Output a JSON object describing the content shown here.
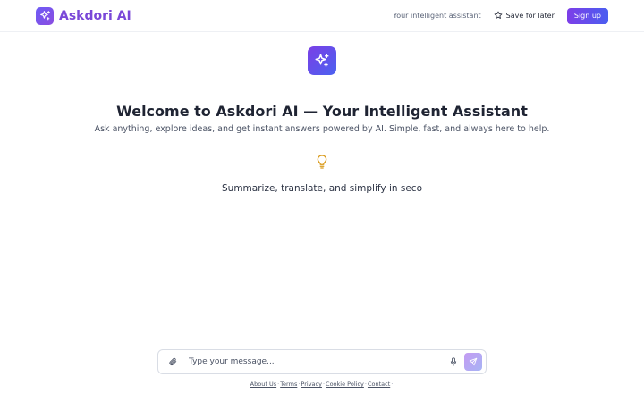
{
  "app": {
    "name": "Askdori AI"
  },
  "header": {
    "tagline": "Your intelligent assistant",
    "save_label": "Save for later",
    "signup_label": "Sign up"
  },
  "hero": {
    "title": "Welcome to Askdori AI — Your Intelligent Assistant",
    "subtitle": "Ask anything, explore ideas, and get instant answers powered by AI. Simple, fast, and always here to help.",
    "typing_text": "Summarize, translate, and simplify in seco"
  },
  "composer": {
    "placeholder": "Type your message...",
    "value": ""
  },
  "footer": {
    "links": [
      "About Us",
      "Terms",
      "Privacy",
      "Cookie Policy",
      "Contact"
    ]
  },
  "colors": {
    "brand_purple": "#7a48d8",
    "gradient_start": "#7d3ee8",
    "gradient_end": "#4a5ef0",
    "bulb": "#d99a1a"
  },
  "icons": {
    "brand": "sparkles-icon",
    "save": "star-icon",
    "hero": "sparkles-icon",
    "idea": "lightbulb-icon",
    "attach": "paperclip-icon",
    "mic": "microphone-icon",
    "send": "send-icon"
  }
}
